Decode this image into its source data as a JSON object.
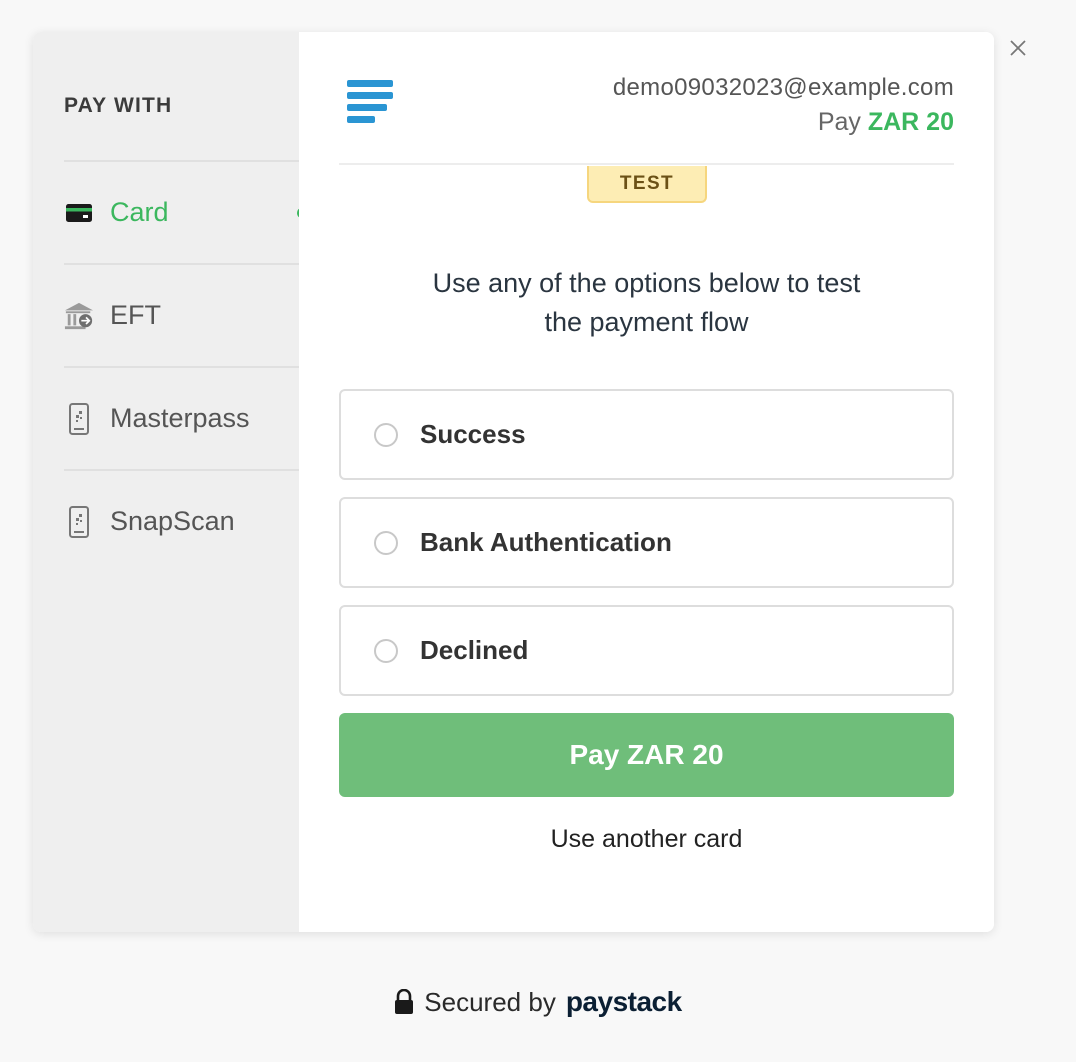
{
  "close": {
    "icon": "close-icon"
  },
  "sidebar": {
    "title": "PAY WITH",
    "items": [
      {
        "label": "Card",
        "icon": "card-icon",
        "active": true
      },
      {
        "label": "EFT",
        "icon": "bank-icon",
        "active": false
      },
      {
        "label": "Masterpass",
        "icon": "phone-qr-icon",
        "active": false
      },
      {
        "label": "SnapScan",
        "icon": "phone-qr-icon",
        "active": false
      }
    ]
  },
  "header": {
    "email": "demo09032023@example.com",
    "pay_prefix": "Pay",
    "amount": "ZAR 20",
    "badge": "TEST"
  },
  "main": {
    "instruction_line1": "Use any of the options below to test",
    "instruction_line2": "the payment flow",
    "options": [
      {
        "label": "Success"
      },
      {
        "label": "Bank Authentication"
      },
      {
        "label": "Declined"
      }
    ],
    "pay_button": "Pay ZAR 20",
    "another_card": "Use another card"
  },
  "footer": {
    "secured_text": "Secured by",
    "brand": "paystack"
  },
  "colors": {
    "accent_green": "#3bb75e",
    "button_green": "#6fbe7a",
    "logo_blue": "#2a95d3",
    "badge_yellow": "#fdedb4"
  }
}
